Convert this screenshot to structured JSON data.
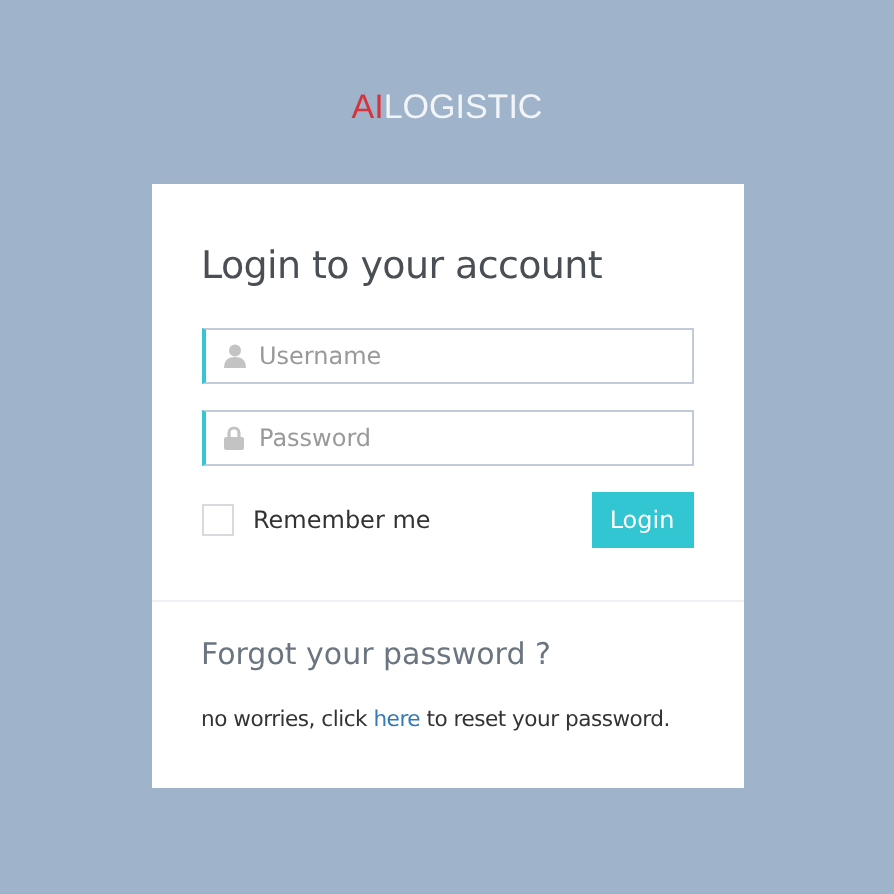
{
  "logo": {
    "prefix": "AI",
    "name": "LOGISTIC"
  },
  "login": {
    "title": "Login to your account",
    "fields": [
      {
        "kind": "user",
        "placeholder": "Username"
      },
      {
        "kind": "lock",
        "placeholder": "Password"
      }
    ],
    "remember": {
      "label": "Remember me",
      "checked": false
    },
    "submit": "Login"
  },
  "forgot": {
    "title": "Forgot your password ?",
    "before": "no worries, click ",
    "link": "here",
    "after": " to reset your password."
  }
}
